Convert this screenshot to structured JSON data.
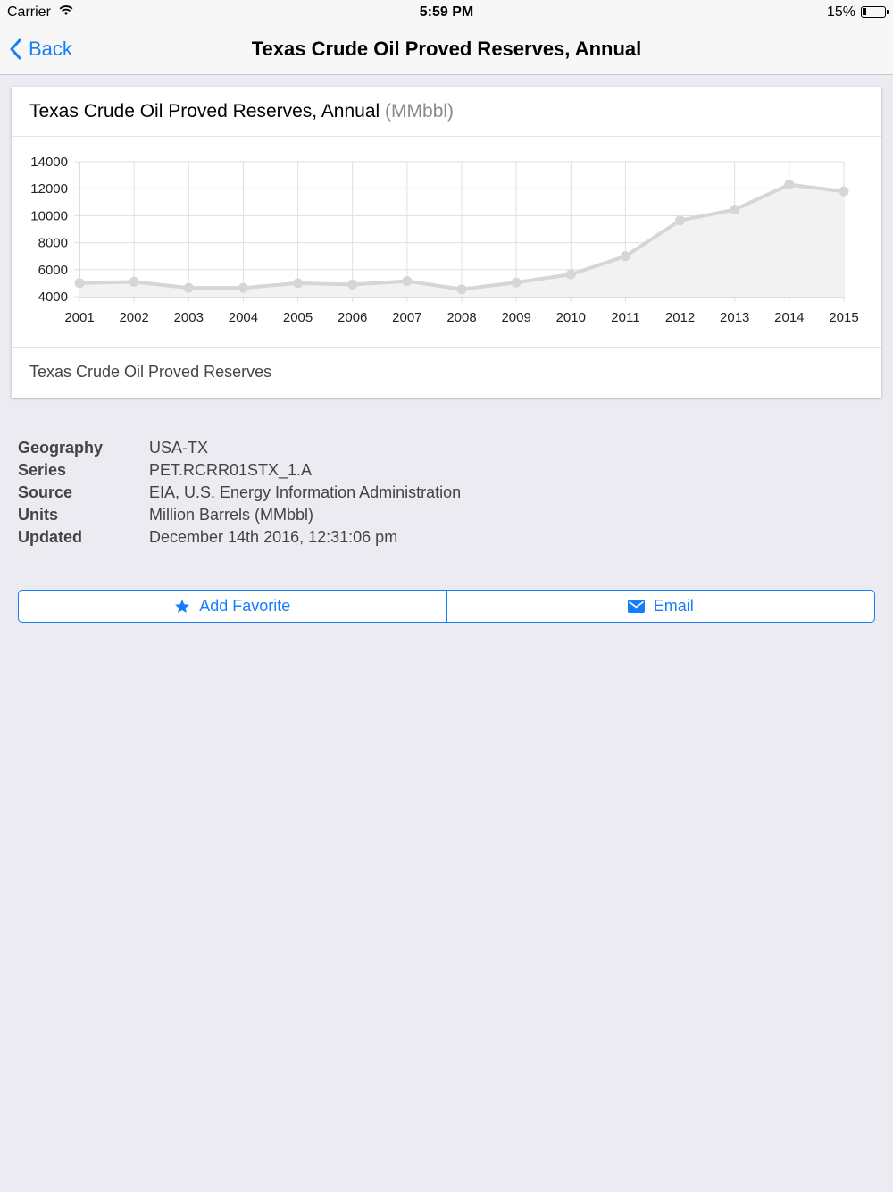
{
  "status_bar": {
    "carrier": "Carrier",
    "time": "5:59 PM",
    "battery": "15%"
  },
  "nav": {
    "back_label": "Back",
    "title": "Texas Crude Oil Proved Reserves, Annual"
  },
  "card": {
    "title": "Texas Crude Oil Proved Reserves, Annual",
    "unit": "(MMbbl)",
    "footer": "Texas Crude Oil Proved Reserves"
  },
  "chart_data": {
    "type": "area",
    "x": [
      "2001",
      "2002",
      "2003",
      "2004",
      "2005",
      "2006",
      "2007",
      "2008",
      "2009",
      "2010",
      "2011",
      "2012",
      "2013",
      "2014",
      "2015"
    ],
    "series": [
      {
        "values": [
          5000,
          5100,
          4650,
          4650,
          5000,
          4900,
          5150,
          4550,
          5050,
          5650,
          7000,
          9650,
          10450,
          12300,
          11800
        ]
      }
    ],
    "yticks": [
      4000,
      6000,
      8000,
      10000,
      12000,
      14000
    ],
    "ylim": [
      4000,
      14000
    ],
    "grid": true,
    "colors": {
      "line": "#d6d6d6",
      "fill": "#f2f2f2",
      "grid": "#e0e0e0"
    }
  },
  "details": [
    {
      "label": "Geography",
      "value": "USA-TX"
    },
    {
      "label": "Series",
      "value": "PET.RCRR01STX_1.A"
    },
    {
      "label": "Source",
      "value": "EIA, U.S. Energy Information Administration"
    },
    {
      "label": "Units",
      "value": "Million Barrels (MMbbl)"
    },
    {
      "label": "Updated",
      "value": "December 14th 2016, 12:31:06 pm"
    }
  ],
  "actions": {
    "favorite_label": "Add Favorite",
    "email_label": "Email"
  },
  "colors": {
    "accent": "#157efb",
    "background": "#ebebf1"
  }
}
